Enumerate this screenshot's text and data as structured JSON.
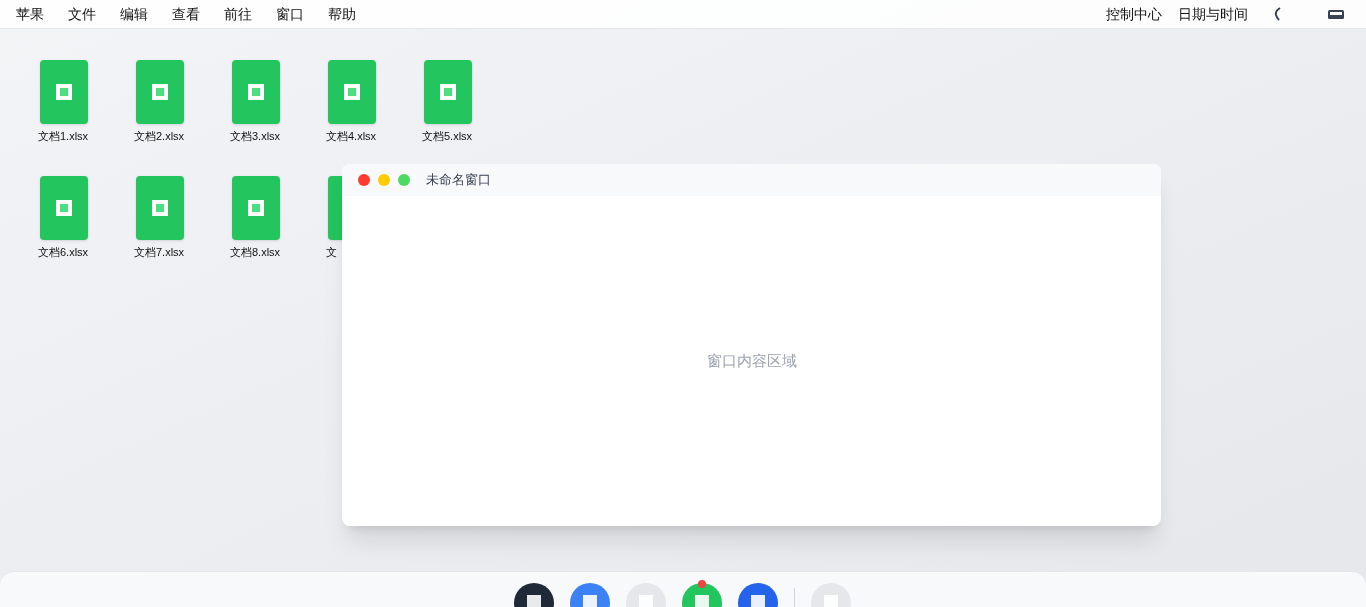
{
  "menu_bar": {
    "menus": [
      "苹果",
      "文件",
      "编辑",
      "查看",
      "前往",
      "窗口",
      "帮助"
    ],
    "status_items": [
      "控制中心",
      "日期与时间"
    ]
  },
  "desktop_files": [
    {
      "label": "文档1.xlsx"
    },
    {
      "label": "文档2.xlsx"
    },
    {
      "label": "文档3.xlsx"
    },
    {
      "label": "文档4.xlsx"
    },
    {
      "label": "文档5.xlsx"
    },
    {
      "label": "文档6.xlsx"
    },
    {
      "label": "文档7.xlsx"
    },
    {
      "label": "文档8.xlsx"
    },
    {
      "label": "文"
    }
  ],
  "window": {
    "title": "未命名窗口",
    "content": "窗口内容区域"
  },
  "dock": {
    "items": [
      {
        "kind": "app",
        "color": "#1f2937",
        "badge": false
      },
      {
        "kind": "app",
        "color": "#3b82f6",
        "badge": false
      },
      {
        "kind": "app",
        "color": "#e5e7eb",
        "badge": false
      },
      {
        "kind": "app",
        "color": "#22c55e",
        "badge": true
      },
      {
        "kind": "app",
        "color": "#2563eb",
        "badge": false
      },
      {
        "kind": "divider"
      },
      {
        "kind": "app",
        "color": "#e5e7eb",
        "badge": false
      }
    ]
  }
}
